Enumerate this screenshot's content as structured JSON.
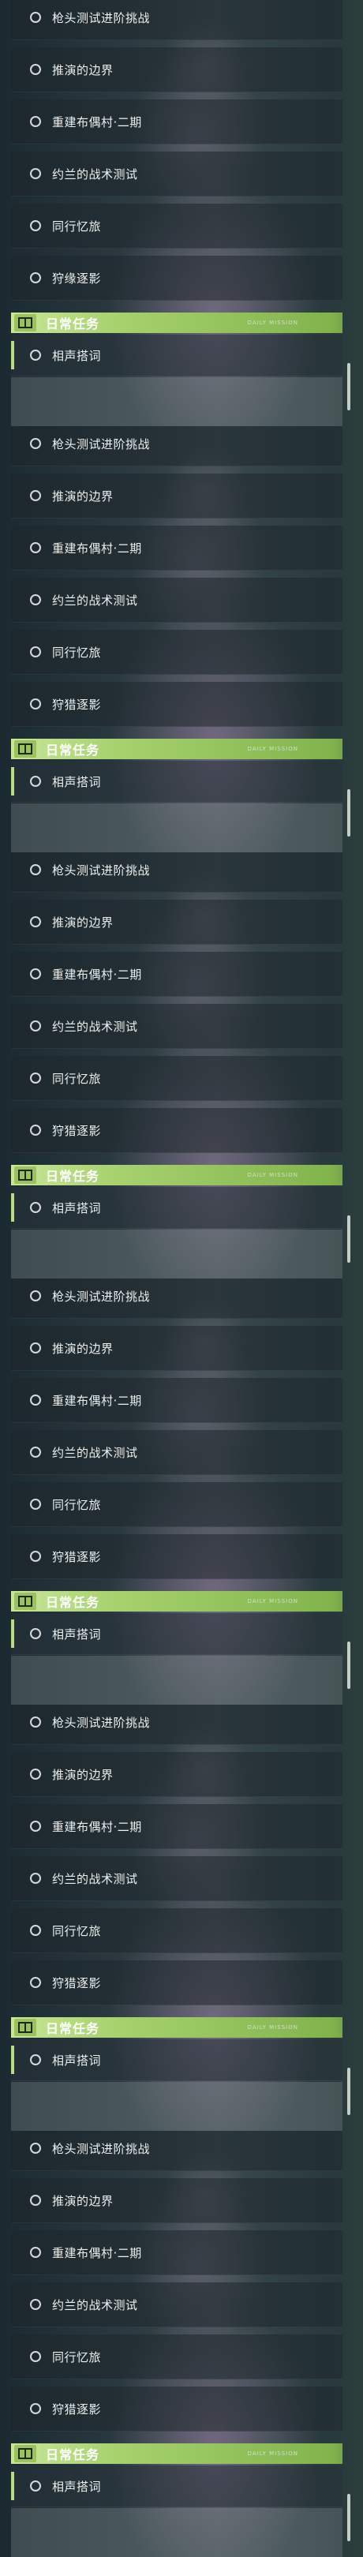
{
  "panels": [
    {
      "items": [
        "枪头测试进阶挑战",
        "推演的边界",
        "重建布偶村·二期",
        "约兰的战术测试",
        "同行忆旅",
        "狩缘逐影"
      ],
      "section_title": "日常任务",
      "section_subtitle": "DAILY MISSION",
      "daily_items": [
        "相声搭词"
      ]
    },
    {
      "items": [
        "枪头测试进阶挑战",
        "推演的边界",
        "重建布偶村·二期",
        "约兰的战术测试",
        "同行忆旅",
        "狩猎逐影"
      ],
      "section_title": "日常任务",
      "section_subtitle": "DAILY MISSION",
      "daily_items": [
        "相声搭词"
      ]
    },
    {
      "items": [
        "枪头测试进阶挑战",
        "推演的边界",
        "重建布偶村·二期",
        "约兰的战术测试",
        "同行忆旅",
        "狩猎逐影"
      ],
      "section_title": "日常任务",
      "section_subtitle": "DAILY MISSION",
      "daily_items": [
        "相声搭词"
      ]
    },
    {
      "items": [
        "枪头测试进阶挑战",
        "推演的边界",
        "重建布偶村·二期",
        "约兰的战术测试",
        "同行忆旅",
        "狩猎逐影"
      ],
      "section_title": "日常任务",
      "section_subtitle": "DAILY MISSION",
      "daily_items": [
        "相声搭词"
      ]
    },
    {
      "items": [
        "枪头测试进阶挑战",
        "推演的边界",
        "重建布偶村·二期",
        "约兰的战术测试",
        "同行忆旅",
        "狩猎逐影"
      ],
      "section_title": "日常任务",
      "section_subtitle": "DAILY MISSION",
      "daily_items": [
        "相声搭词"
      ]
    },
    {
      "items": [
        "枪头测试进阶挑战",
        "推演的边界",
        "重建布偶村·二期",
        "约兰的战术测试",
        "同行忆旅",
        "狩猎逐影"
      ],
      "section_title": "日常任务",
      "section_subtitle": "DAILY MISSION",
      "daily_items": [
        "相声搭词"
      ]
    }
  ],
  "colors": {
    "accent": "#a8d36f",
    "text": "#eef0ee"
  },
  "icons": {
    "status": "circle-icon",
    "section": "book-icon"
  }
}
